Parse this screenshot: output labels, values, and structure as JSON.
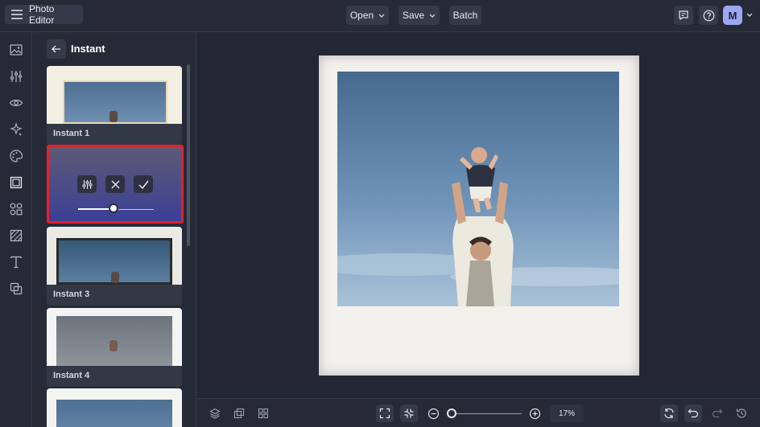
{
  "header": {
    "app_title": "Photo Editor",
    "menu": [
      {
        "label": "Open",
        "has_dropdown": true
      },
      {
        "label": "Save",
        "has_dropdown": true
      },
      {
        "label": "Batch",
        "has_dropdown": false
      }
    ],
    "right_icons": [
      "comments-icon",
      "help-icon"
    ],
    "avatar_initial": "M"
  },
  "left_rail": {
    "icons": [
      "image-icon",
      "adjustments-icon",
      "eye-icon",
      "sparkle-effects-icon",
      "palette-icon",
      "frame-icon",
      "graphics-icon",
      "texture-icon",
      "text-icon",
      "overlay-icon"
    ]
  },
  "panel": {
    "title": "Instant",
    "items": [
      {
        "label": "Instant 1"
      },
      {
        "label": "Instant 3"
      },
      {
        "label": "Instant 4"
      }
    ],
    "selected_intensity": 0.47
  },
  "canvas": {
    "zoom": "17%",
    "zoom_level": 0.17
  },
  "colors": {
    "accent": "#9ba7f2",
    "selection_border": "#e5202b",
    "background": "#232734"
  }
}
